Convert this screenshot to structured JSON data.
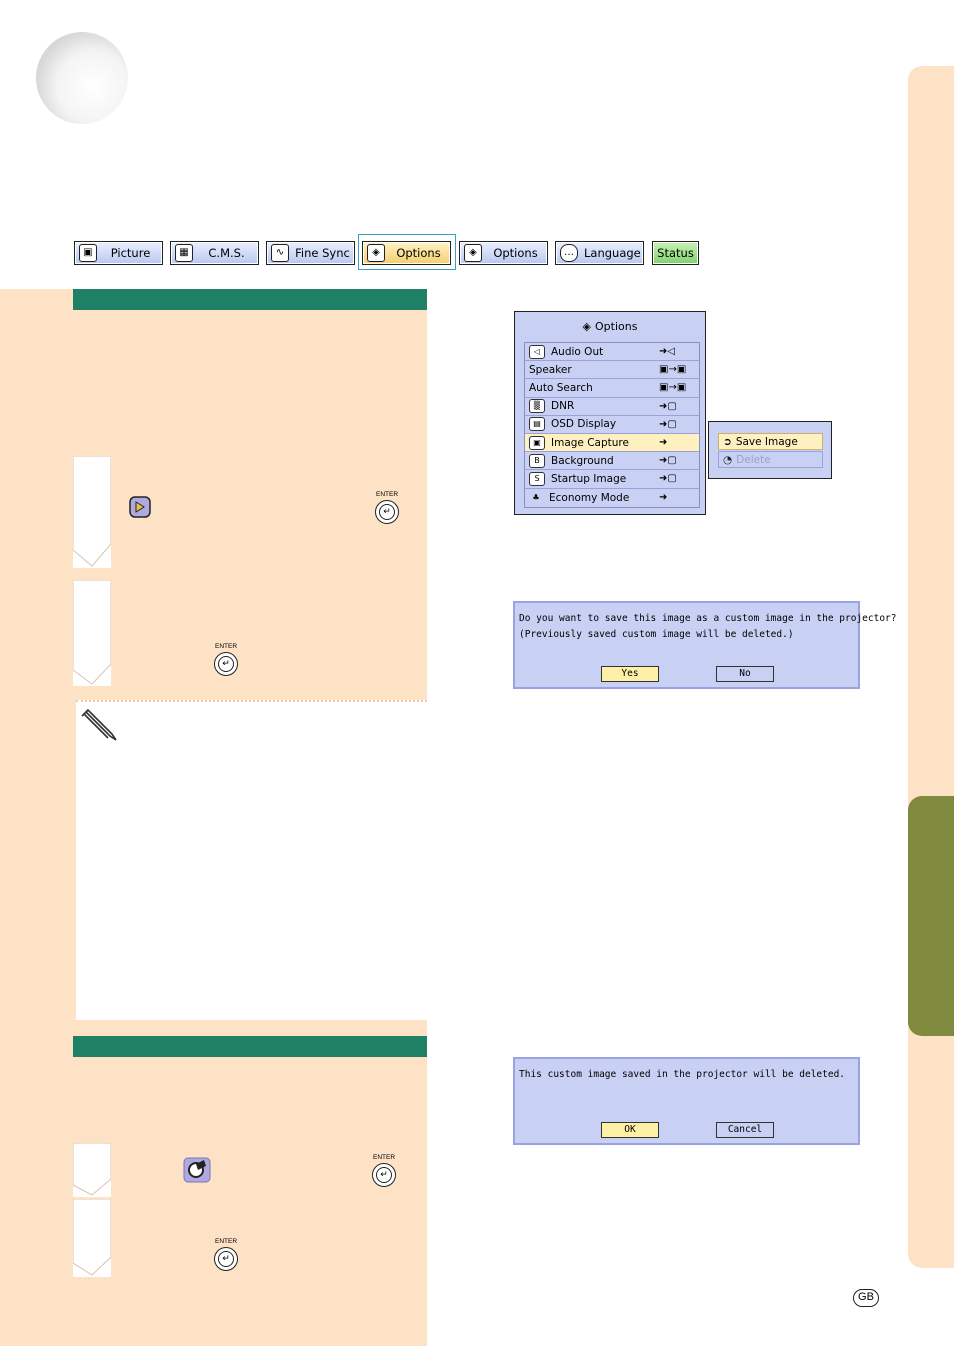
{
  "menu_tabs": [
    {
      "label": "Picture",
      "icon": "picture-icon"
    },
    {
      "label": "C.M.S.",
      "icon": "cms-icon"
    },
    {
      "label": "Fine Sync",
      "icon": "fine-sync-icon"
    },
    {
      "label": "Options",
      "icon": "options-icon"
    },
    {
      "label": "Options",
      "icon": "options-icon"
    },
    {
      "label": "Language",
      "icon": "language-icon"
    },
    {
      "label": "Status",
      "icon": ""
    }
  ],
  "enter_label": "ENTER",
  "options_menu": {
    "title": "Options",
    "items": [
      {
        "label": "Audio Out",
        "icon": "speaker-icon"
      },
      {
        "label": "Speaker",
        "icon": ""
      },
      {
        "label": "Auto Search",
        "icon": ""
      },
      {
        "label": "DNR",
        "icon": "dnr-icon"
      },
      {
        "label": "OSD Display",
        "icon": "osd-display-icon"
      },
      {
        "label": "Image Capture",
        "icon": "image-capture-icon",
        "selected": true
      },
      {
        "label": "Background",
        "icon": "background-icon"
      },
      {
        "label": "Startup Image",
        "icon": "startup-image-icon"
      },
      {
        "label": "Economy Mode",
        "icon": "economy-mode-icon"
      }
    ],
    "submenu": [
      {
        "label": "Save Image",
        "selected": true
      },
      {
        "label": "Delete",
        "disabled": true
      }
    ]
  },
  "save_dialog": {
    "line1": "Do you want to save this image as a custom image in the projector?",
    "line2": "(Previously saved custom image will be deleted.)",
    "yes_label": "Yes",
    "no_label": "No"
  },
  "delete_dialog": {
    "line1": "This custom image saved in the projector will be deleted.",
    "ok_label": "OK",
    "cancel_label": "Cancel"
  },
  "region_badge": "GB",
  "colors": {
    "panel": "#fde2c6",
    "section_bar": "#1e8064",
    "side_tab_active": "#7f8a3e",
    "osd_background": "#c8d0f4"
  }
}
